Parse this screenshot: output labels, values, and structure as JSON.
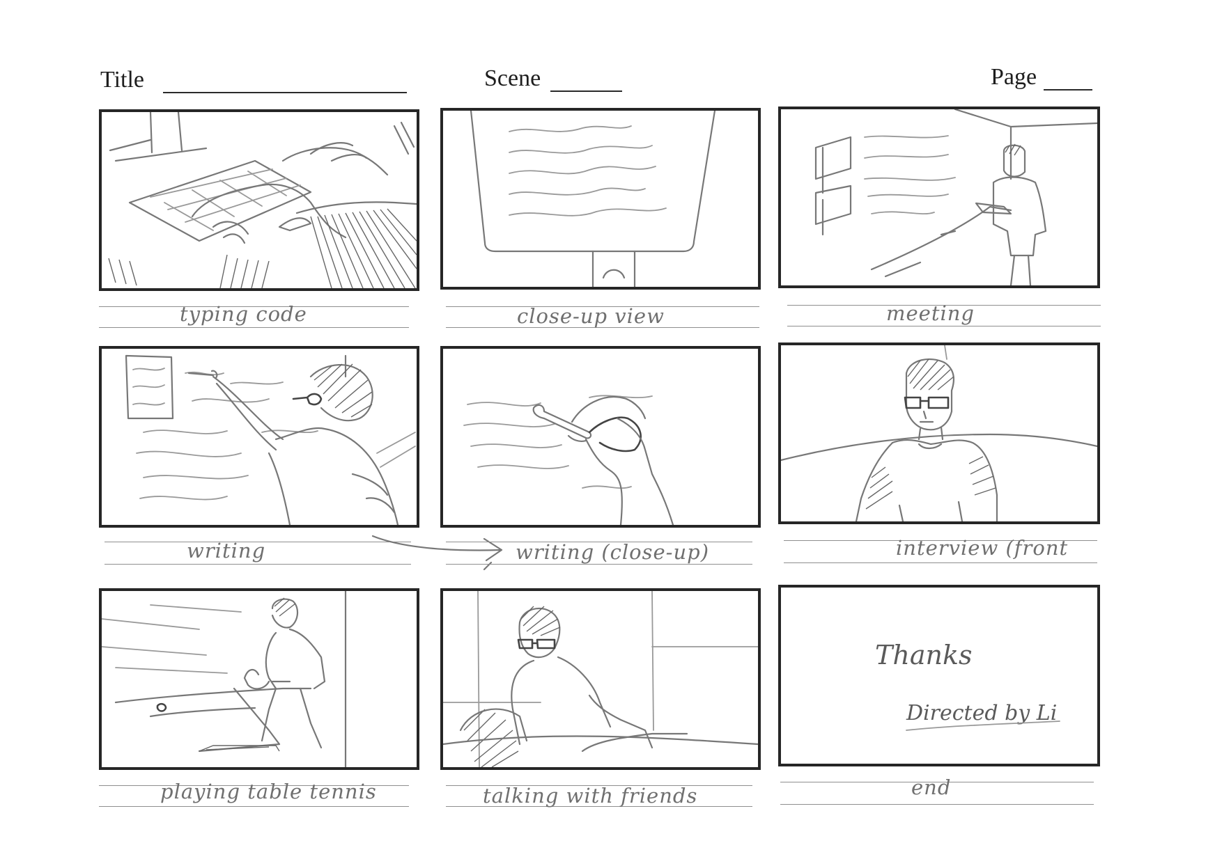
{
  "header": {
    "title_label": "Title",
    "scene_label": "Scene",
    "page_label": "Page"
  },
  "panels": [
    {
      "caption": "typing code",
      "subject": "hands typing on keyboard"
    },
    {
      "caption": "close-up view",
      "subject": "monitor with text"
    },
    {
      "caption": "meeting",
      "subject": "person standing at whiteboard"
    },
    {
      "caption": "writing",
      "subject": "person writing on whiteboard"
    },
    {
      "caption": "writing (close-up)",
      "subject": "hand holding marker"
    },
    {
      "caption": "interview (front",
      "subject": "person facing camera"
    },
    {
      "caption": "playing table tennis",
      "subject": "person with paddle at table"
    },
    {
      "caption": "talking with friends",
      "subject": "seated person"
    },
    {
      "caption": "end",
      "subject": "credits",
      "thanks_text": "Thanks",
      "credit_text": "Directed by Li"
    }
  ]
}
